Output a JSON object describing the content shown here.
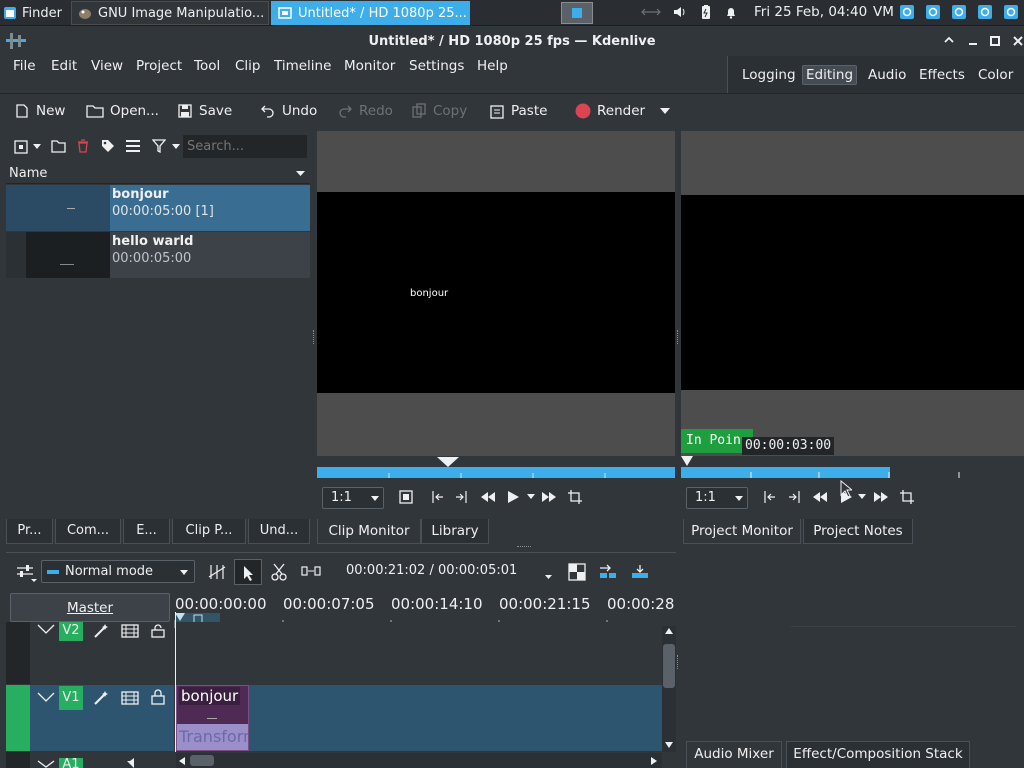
{
  "taskbar": {
    "tasks": [
      {
        "label": "Finder"
      },
      {
        "label": "GNU Image Manipulatio..."
      },
      {
        "label": "Untitled* / HD 1080p 25..."
      }
    ],
    "clock": "Fri 25 Feb, 04:40",
    "keyboard_layout": "VM"
  },
  "window": {
    "title": "Untitled* / HD 1080p 25 fps — Kdenlive"
  },
  "menu": {
    "items": [
      {
        "label": "File"
      },
      {
        "label": "Edit"
      },
      {
        "label": "View"
      },
      {
        "label": "Project"
      },
      {
        "label": "Tool"
      },
      {
        "label": "Clip"
      },
      {
        "label": "Timeline"
      },
      {
        "label": "Monitor"
      },
      {
        "label": "Settings"
      },
      {
        "label": "Help"
      }
    ],
    "layouts": [
      {
        "label": "Logging"
      },
      {
        "label": "Editing"
      },
      {
        "label": "Audio"
      },
      {
        "label": "Effects"
      },
      {
        "label": "Color"
      }
    ],
    "active_layout": "Editing"
  },
  "toolbar": {
    "new": "New",
    "open": "Open...",
    "save": "Save",
    "undo": "Undo",
    "redo": "Redo",
    "copy": "Copy",
    "paste": "Paste",
    "render": "Render"
  },
  "bin": {
    "search_placeholder": "Search...",
    "column": "Name",
    "clips": [
      {
        "name": "bonjour",
        "duration": "00:00:05:00 [1]",
        "selected": true
      },
      {
        "name": "hello warld",
        "duration": "00:00:05:00",
        "selected": false
      }
    ],
    "tabs": [
      {
        "label": "Pr..."
      },
      {
        "label": "Com..."
      },
      {
        "label": "E..."
      },
      {
        "label": "Clip P..."
      },
      {
        "label": "Und..."
      }
    ]
  },
  "clip_monitor": {
    "overlay_text": "bonjour",
    "zoom": "1:1",
    "tabs": [
      {
        "label": "Clip Monitor"
      },
      {
        "label": "Library"
      }
    ]
  },
  "project_monitor": {
    "in_point_label": "In Poin",
    "timecode": "00:00:03:00",
    "zoom": "1:1",
    "tabs": [
      {
        "label": "Project Monitor"
      },
      {
        "label": "Project Notes"
      }
    ]
  },
  "right_bottom_tabs": [
    {
      "label": "Audio Mixer"
    },
    {
      "label": "Effect/Composition Stack"
    }
  ],
  "timeline": {
    "mode": "Normal mode",
    "position": "00:00:21:02 / 00:00:05:01",
    "master_label": "Master",
    "ruler_labels": [
      "00:00:00:00",
      "00:00:07:05",
      "00:00:14:10",
      "00:00:21:15",
      "00:00:28"
    ],
    "tracks": [
      {
        "name": "V2"
      },
      {
        "name": "V1"
      },
      {
        "name": "A1"
      }
    ],
    "clip": {
      "title": "bonjour",
      "effect": "Transform"
    }
  },
  "colors": {
    "accent": "#3daee9",
    "track_active": "#27ae60",
    "clip_purple": "#4e2a55",
    "in_point_green": "#1e9e3e",
    "render_red": "#da4453"
  }
}
